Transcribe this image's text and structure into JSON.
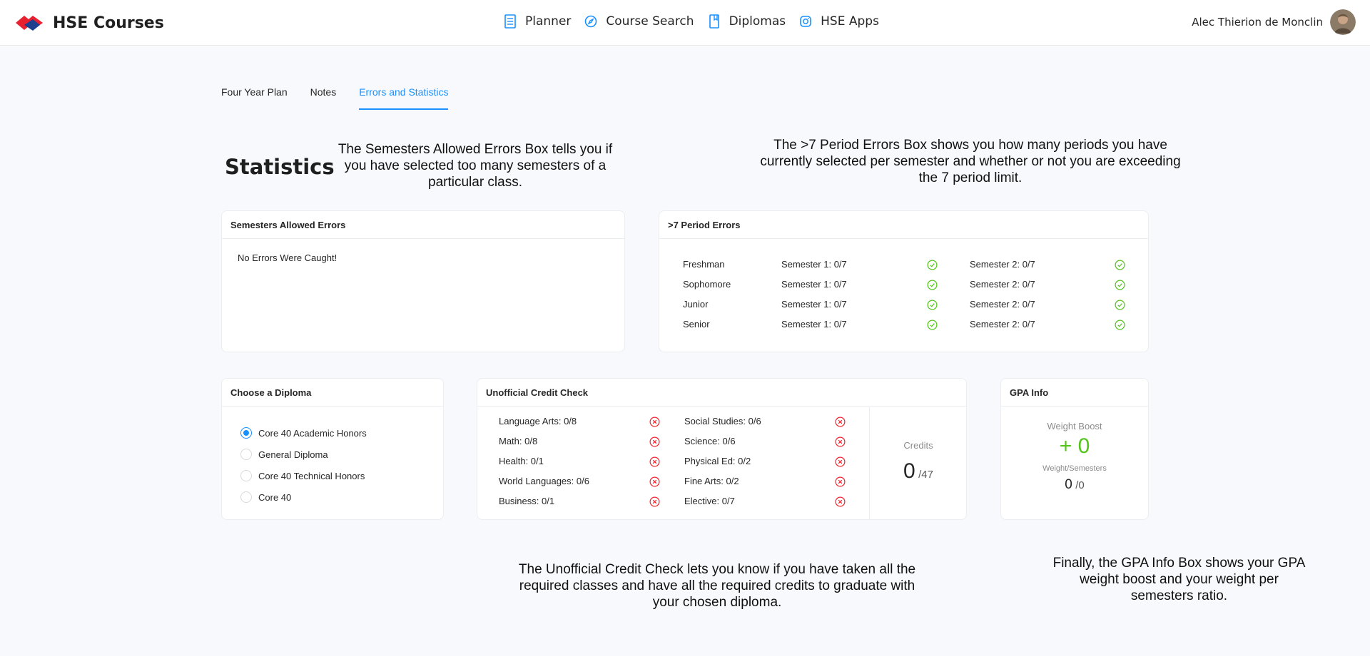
{
  "app": {
    "name": "HSE Courses",
    "logo_icon": "hse-logo-icon"
  },
  "nav": [
    {
      "label": "Planner",
      "icon": "planner-icon"
    },
    {
      "label": "Course Search",
      "icon": "compass-icon"
    },
    {
      "label": "Diplomas",
      "icon": "book-icon"
    },
    {
      "label": "HSE Apps",
      "icon": "instagram-icon"
    }
  ],
  "user": {
    "name": "Alec Thierion de Monclin"
  },
  "tabs": [
    {
      "label": "Four Year Plan",
      "active": false
    },
    {
      "label": "Notes",
      "active": false
    },
    {
      "label": "Errors and Statistics",
      "active": true
    }
  ],
  "page_title": "Statistics",
  "annotations": {
    "semesters": "The Semesters Allowed Errors Box tells you if you have selected too many semesters of a particular class.",
    "periods": "The >7 Period Errors Box shows you how many periods you have currently selected per semester and whether or not you are exceeding the 7 period limit.",
    "credits": "The Unofficial Credit Check lets you know if you have taken all the required classes and have all the required credits to graduate with your chosen diploma.",
    "gpa": "Finally, the GPA Info Box shows your GPA weight boost and your weight per semesters ratio."
  },
  "semesters_allowed": {
    "title": "Semesters Allowed Errors",
    "message": "No Errors Were Caught!"
  },
  "period_errors": {
    "title": ">7 Period Errors",
    "rows": [
      {
        "year": "Freshman",
        "s1": "Semester 1: 0/7",
        "s2": "Semester 2: 0/7"
      },
      {
        "year": "Sophomore",
        "s1": "Semester 1: 0/7",
        "s2": "Semester 2: 0/7"
      },
      {
        "year": "Junior",
        "s1": "Semester 1: 0/7",
        "s2": "Semester 2: 0/7"
      },
      {
        "year": "Senior",
        "s1": "Semester 1: 0/7",
        "s2": "Semester 2: 0/7"
      }
    ]
  },
  "diploma": {
    "title": "Choose a Diploma",
    "options": [
      {
        "label": "Core 40 Academic Honors",
        "selected": true
      },
      {
        "label": "General Diploma",
        "selected": false
      },
      {
        "label": "Core 40 Technical Honors",
        "selected": false
      },
      {
        "label": "Core 40",
        "selected": false
      }
    ]
  },
  "credit_check": {
    "title": "Unofficial Credit Check",
    "left": [
      "Language Arts: 0/8",
      "Math: 0/8",
      "Health: 0/1",
      "World Languages: 0/6",
      "Business: 0/1"
    ],
    "right": [
      "Social Studies: 0/6",
      "Science: 0/6",
      "Physical Ed: 0/2",
      "Fine Arts: 0/2",
      "Elective: 0/7"
    ],
    "credits_label": "Credits",
    "credits_value": "0",
    "credits_max": "/47"
  },
  "gpa": {
    "title": "GPA Info",
    "boost_label": "Weight Boost",
    "boost_value": "+ 0",
    "ratio_label": "Weight/Semesters",
    "ratio_value": "0",
    "ratio_max": "/0"
  },
  "colors": {
    "accent": "#1890ff",
    "success": "#52c41a",
    "error": "#f5222d",
    "brand_red": "#e8202f",
    "brand_blue": "#1f3f8f"
  }
}
